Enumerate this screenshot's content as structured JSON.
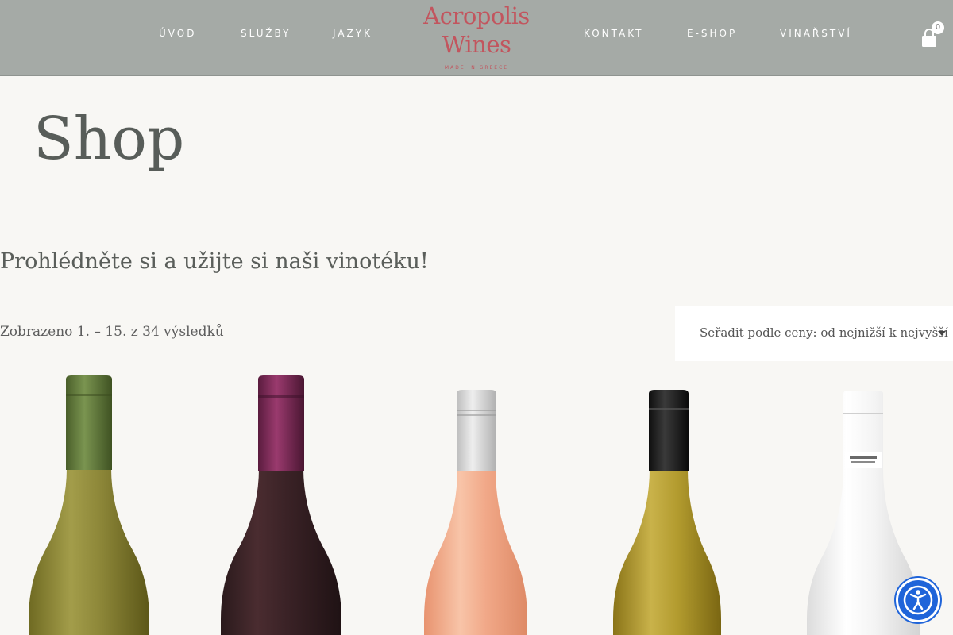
{
  "nav": {
    "left_items": [
      {
        "label": "ÚVOD"
      },
      {
        "label": "SLUŽBY"
      },
      {
        "label": "JAZYK"
      }
    ],
    "right_items": [
      {
        "label": "KONTAKT"
      },
      {
        "label": "E-SHOP",
        "active": true
      },
      {
        "label": "VINAŘSTVÍ"
      }
    ]
  },
  "logo": {
    "line1": "Acropolis",
    "line2": "Wines",
    "tagline": "MADE IN GREECE"
  },
  "cart": {
    "count": "0",
    "icon": "shopping-bag-icon"
  },
  "page": {
    "title": "Shop",
    "intro": "Prohlédněte si a užijte si naši vinotéku!",
    "result_count": "Zobrazeno 1. – 15. z 34 výsledků",
    "sort_label": "Seřadit podle ceny: od nejnižší k nejvyšší"
  },
  "products": [
    {
      "icon": "white-wine-bottle-icon",
      "glass": "#8a8a3a",
      "cap": "#5f7a3a"
    },
    {
      "icon": "red-wine-bottle-icon",
      "glass": "#3a1e22",
      "cap": "#7a2a55"
    },
    {
      "icon": "rose-wine-bottle-icon",
      "glass": "#f3a98a",
      "cap": "#d9d9d9"
    },
    {
      "icon": "white-wine-bottle-icon",
      "glass": "#b29b2e",
      "cap": "#1d1d1d"
    },
    {
      "icon": "frosted-bottle-icon",
      "glass": "#f2f2f2",
      "cap": "#f7f7f7"
    }
  ],
  "colors": {
    "header_bg": "#a5aaa6",
    "logo": "#c2555e",
    "nav_active_underline": "#e3c2b2",
    "page_bg": "#f8f7f4",
    "accessibility_button": "#1f64d9"
  }
}
